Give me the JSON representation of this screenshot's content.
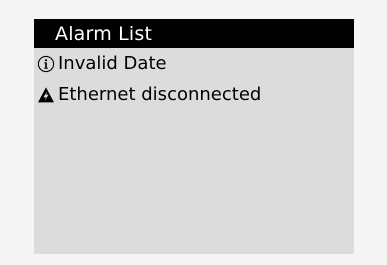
{
  "header": {
    "title": "Alarm List"
  },
  "alarms": [
    {
      "icon": "info-icon",
      "text": "Invalid Date"
    },
    {
      "icon": "warning-icon",
      "text": "Ethernet disconnected"
    }
  ],
  "colors": {
    "page_background": "#f5f5f5",
    "screen_background": "#dcdcdc",
    "titlebar_background": "#000000",
    "titlebar_text": "#ffffff",
    "item_text": "#000000"
  }
}
